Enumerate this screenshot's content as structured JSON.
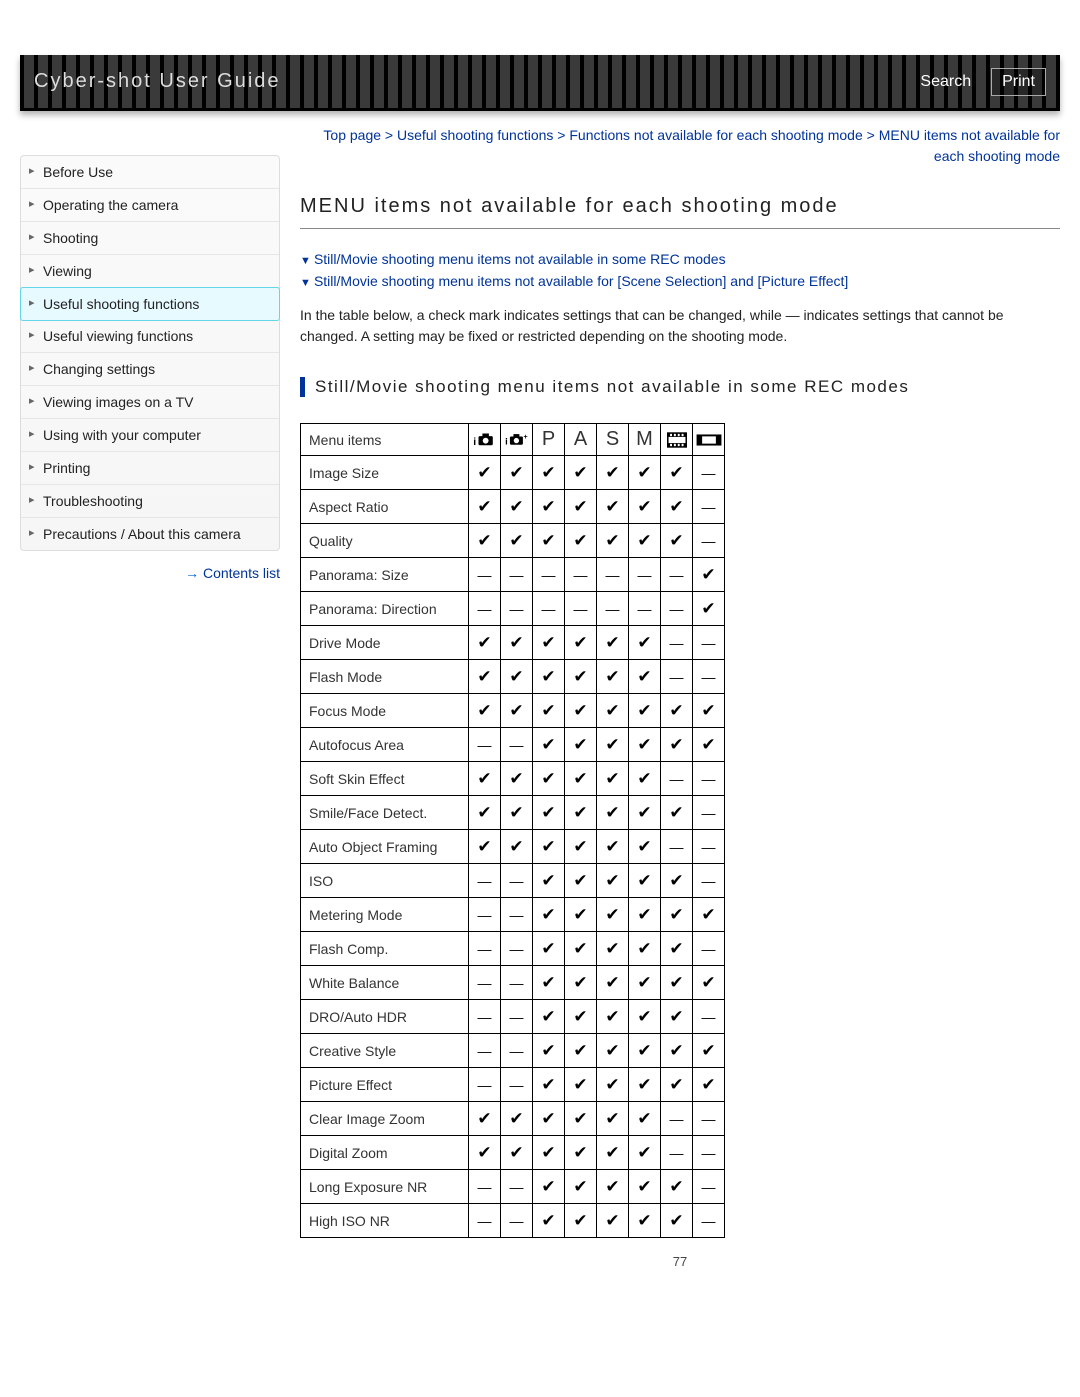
{
  "header": {
    "title": "Cyber-shot User Guide",
    "search": "Search",
    "print": "Print"
  },
  "sidebar": {
    "items": [
      "Before Use",
      "Operating the camera",
      "Shooting",
      "Viewing",
      "Useful shooting functions",
      "Useful viewing functions",
      "Changing settings",
      "Viewing images on a TV",
      "Using with your computer",
      "Printing",
      "Troubleshooting",
      "Precautions / About this camera"
    ],
    "active_index": 4,
    "contents_link": "Contents list"
  },
  "breadcrumb": "Top page > Useful shooting functions > Functions not available for each shooting mode > MENU items not available for each shooting mode",
  "page_title": "MENU items not available for each shooting mode",
  "anchors": [
    "Still/Movie shooting menu items not available in some REC modes",
    "Still/Movie shooting menu items not available for [Scene Selection] and [Picture Effect]"
  ],
  "description": "In the table below, a check mark indicates settings that can be changed, while — indicates settings that cannot be changed. A setting may be fixed or restricted depending on the shooting mode.",
  "section_heading": "Still/Movie shooting menu items not available in some REC modes",
  "table": {
    "header_label": "Menu items",
    "mode_labels": [
      "iAuto",
      "iAuto+",
      "P",
      "A",
      "S",
      "M",
      "Movie",
      "Panorama"
    ],
    "mode_display": [
      "icon:iauto",
      "icon:iauto+",
      "P",
      "A",
      "S",
      "M",
      "icon:movie",
      "icon:panorama"
    ],
    "rows": [
      {
        "name": "Image Size",
        "v": [
          1,
          1,
          1,
          1,
          1,
          1,
          1,
          0
        ]
      },
      {
        "name": "Aspect Ratio",
        "v": [
          1,
          1,
          1,
          1,
          1,
          1,
          1,
          0
        ]
      },
      {
        "name": "Quality",
        "v": [
          1,
          1,
          1,
          1,
          1,
          1,
          1,
          0
        ]
      },
      {
        "name": "Panorama: Size",
        "v": [
          0,
          0,
          0,
          0,
          0,
          0,
          0,
          1
        ]
      },
      {
        "name": "Panorama: Direction",
        "v": [
          0,
          0,
          0,
          0,
          0,
          0,
          0,
          1
        ]
      },
      {
        "name": "Drive Mode",
        "v": [
          1,
          1,
          1,
          1,
          1,
          1,
          0,
          0
        ]
      },
      {
        "name": "Flash Mode",
        "v": [
          1,
          1,
          1,
          1,
          1,
          1,
          0,
          0
        ]
      },
      {
        "name": "Focus Mode",
        "v": [
          1,
          1,
          1,
          1,
          1,
          1,
          1,
          1
        ]
      },
      {
        "name": "Autofocus Area",
        "v": [
          0,
          0,
          1,
          1,
          1,
          1,
          1,
          1
        ]
      },
      {
        "name": "Soft Skin Effect",
        "v": [
          1,
          1,
          1,
          1,
          1,
          1,
          0,
          0
        ]
      },
      {
        "name": "Smile/Face Detect.",
        "v": [
          1,
          1,
          1,
          1,
          1,
          1,
          1,
          0
        ]
      },
      {
        "name": "Auto Object Framing",
        "v": [
          1,
          1,
          1,
          1,
          1,
          1,
          0,
          0
        ]
      },
      {
        "name": "ISO",
        "v": [
          0,
          0,
          1,
          1,
          1,
          1,
          1,
          0
        ]
      },
      {
        "name": "Metering Mode",
        "v": [
          0,
          0,
          1,
          1,
          1,
          1,
          1,
          1
        ]
      },
      {
        "name": "Flash Comp.",
        "v": [
          0,
          0,
          1,
          1,
          1,
          1,
          1,
          0
        ]
      },
      {
        "name": "White Balance",
        "v": [
          0,
          0,
          1,
          1,
          1,
          1,
          1,
          1
        ]
      },
      {
        "name": "DRO/Auto HDR",
        "v": [
          0,
          0,
          1,
          1,
          1,
          1,
          1,
          0
        ]
      },
      {
        "name": "Creative Style",
        "v": [
          0,
          0,
          1,
          1,
          1,
          1,
          1,
          1
        ]
      },
      {
        "name": "Picture Effect",
        "v": [
          0,
          0,
          1,
          1,
          1,
          1,
          1,
          1
        ]
      },
      {
        "name": "Clear Image Zoom",
        "v": [
          1,
          1,
          1,
          1,
          1,
          1,
          0,
          0
        ]
      },
      {
        "name": "Digital Zoom",
        "v": [
          1,
          1,
          1,
          1,
          1,
          1,
          0,
          0
        ]
      },
      {
        "name": "Long Exposure NR",
        "v": [
          0,
          0,
          1,
          1,
          1,
          1,
          1,
          0
        ]
      },
      {
        "name": "High ISO NR",
        "v": [
          0,
          0,
          1,
          1,
          1,
          1,
          1,
          0
        ]
      }
    ]
  },
  "page_number": "77"
}
